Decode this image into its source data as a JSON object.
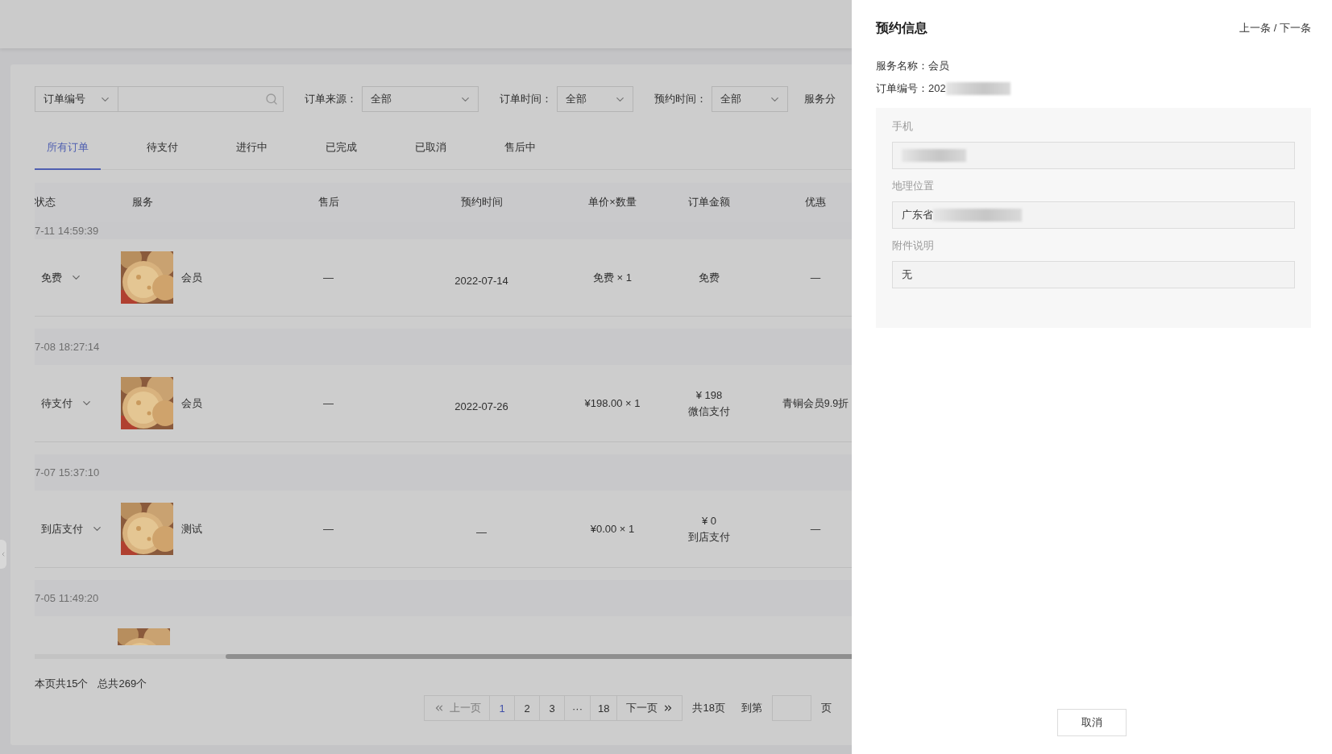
{
  "filter_bar": {
    "order_number_select": "订单编号",
    "filters": [
      {
        "label": "订单来源：",
        "value": "全部"
      },
      {
        "label": "订单时间：",
        "value": "全部"
      },
      {
        "label": "预约时间：",
        "value": "全部"
      }
    ],
    "cut_label": "服务分"
  },
  "tabs": [
    {
      "label": "所有订单",
      "selected": true
    },
    {
      "label": "待支付",
      "selected": false
    },
    {
      "label": "进行中",
      "selected": false
    },
    {
      "label": "已完成",
      "selected": false
    },
    {
      "label": "已取消",
      "selected": false
    },
    {
      "label": "售后中",
      "selected": false
    }
  ],
  "table": {
    "columns": [
      "状态",
      "服务",
      "售后",
      "预约时间",
      "单价×数量",
      "订单金额",
      "优惠"
    ],
    "groups": [
      {
        "time": "7-11 14:59:39",
        "partial": true,
        "item": {
          "kind": "full",
          "status": "免费",
          "service": "会员",
          "after_sale": "—",
          "appointment": "2022-07-14",
          "price_qty": "免费 × 1",
          "amount": "免费",
          "discount": "—"
        }
      },
      {
        "time": "7-08 18:27:14",
        "partial": false,
        "item": {
          "kind": "full",
          "status": "待支付",
          "service": "会员",
          "after_sale": "—",
          "appointment": "2022-07-26",
          "price_qty": "¥198.00 × 1",
          "amount": "¥ 198",
          "amount_note": "微信支付",
          "discount": "青铜会员9.9折"
        }
      },
      {
        "time": "7-07 15:37:10",
        "partial": false,
        "item": {
          "kind": "full",
          "status": "到店支付",
          "service": "测试",
          "after_sale": "—",
          "appointment": "—",
          "price_qty": "¥0.00 × 1",
          "amount": "¥ 0",
          "amount_note": "到店支付",
          "discount": "—"
        }
      },
      {
        "time": "7-05 11:49:20",
        "partial": false,
        "item": {
          "kind": "partial"
        }
      }
    ]
  },
  "summary": {
    "page_count": "本页共15个",
    "total": "总共269个"
  },
  "pagination": {
    "prev": {
      "label": "上一页",
      "disabled": true
    },
    "pages": [
      {
        "label": "1",
        "selected": true
      },
      {
        "label": "2",
        "selected": false
      },
      {
        "label": "3",
        "selected": false
      },
      {
        "label": "···",
        "selected": false
      },
      {
        "label": "18",
        "selected": false
      }
    ],
    "next": {
      "label": "下一页",
      "disabled": false
    },
    "total_pages": "共18页",
    "goto_label": "到第",
    "goto_unit": "页"
  },
  "drawer": {
    "title": "预约信息",
    "nav": "上一条 / 下一条",
    "info": [
      {
        "label": "服务名称：",
        "value": "会员",
        "redacted": false
      },
      {
        "label": "订单编号：",
        "value": "202",
        "redacted": true
      }
    ],
    "fields": [
      {
        "label": "手机",
        "redacted": true
      },
      {
        "label": "地理位置",
        "value": "广东省",
        "redacted": true
      },
      {
        "label": "附件说明",
        "value": "无",
        "redacted": false
      }
    ],
    "cancel_button": "取消"
  }
}
